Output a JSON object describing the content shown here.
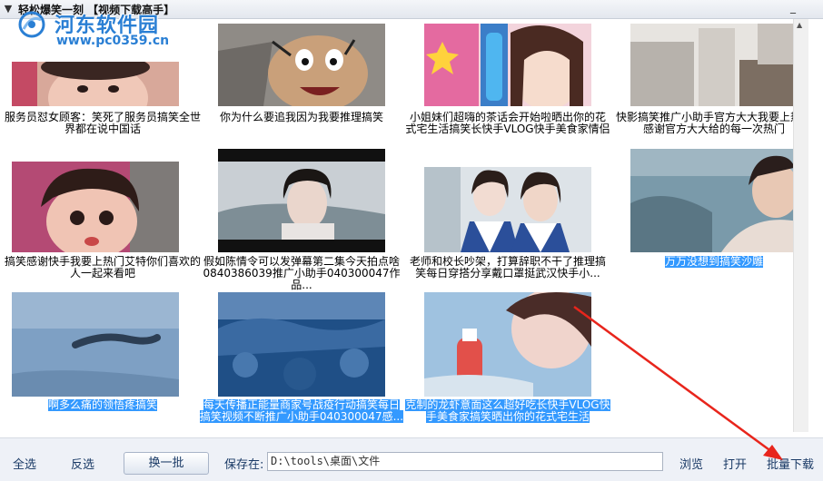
{
  "window": {
    "title": "轻松爆笑一刻 【视频下载高手】",
    "minimize_symbol": "_"
  },
  "watermark": {
    "name": "河东软件园",
    "url": "www.pc0359.cn"
  },
  "videos": [
    {
      "title": "服务员怼女顾客：笑死了服务员搞笑全世界都在说中国话",
      "selected": false,
      "icon": "video-thumbnail-icon"
    },
    {
      "title": "你为什么要追我因为我要推理搞笑",
      "selected": false,
      "icon": "video-thumbnail-icon"
    },
    {
      "title": "小姐妹们超嗨的茶话会开始啦晒出你的花式宅生活搞笑长快手VLOG快手美食家情侣",
      "selected": false,
      "icon": "video-thumbnail-icon"
    },
    {
      "title": "快影搞笑推广小助手官方大大我要上热门感谢官方大大给的每一次热门",
      "selected": false,
      "icon": "video-thumbnail-icon"
    },
    {
      "title": "搞笑感谢快手我要上热门艾特你们喜欢的人一起来看吧",
      "selected": false,
      "icon": "video-thumbnail-icon"
    },
    {
      "title": "假如陈情令可以发弹幕第二集今天拍点啥0840386039推广小助手040300047作品...",
      "selected": false,
      "icon": "video-thumbnail-icon"
    },
    {
      "title": "老师和校长吵架，打算辞职不干了推理搞笑每日穿搭分享戴口罩挺武汉快手小...",
      "selected": false,
      "icon": "video-thumbnail-icon"
    },
    {
      "title": "万万没想到搞笑沙雕",
      "selected": true,
      "icon": "video-thumbnail-icon"
    },
    {
      "title": "啊多么痛的领悟疼搞笑",
      "selected": true,
      "icon": "video-thumbnail-icon"
    },
    {
      "title": "每天传播正能量商家号战疫行动搞笑每日搞笑视频不断推广小助手040300047感...",
      "selected": true,
      "icon": "video-thumbnail-icon"
    },
    {
      "title": "克制的龙虾意面这么超好吃长快手VLOG快手美食家搞笑晒出你的花式宅生活",
      "selected": true,
      "icon": "video-thumbnail-icon"
    }
  ],
  "toolbar": {
    "select_all": "全选",
    "invert": "反选",
    "next_batch": "换一批",
    "save_to_label": "保存在:",
    "save_path": "D:\\tools\\桌面\\文件",
    "browse": "浏览",
    "open": "打开",
    "batch_download": "批量下载"
  },
  "colors": {
    "selection": "#3399ff",
    "accent_arrow": "#e8251c",
    "toolbar_bg": "#eef1f7"
  }
}
